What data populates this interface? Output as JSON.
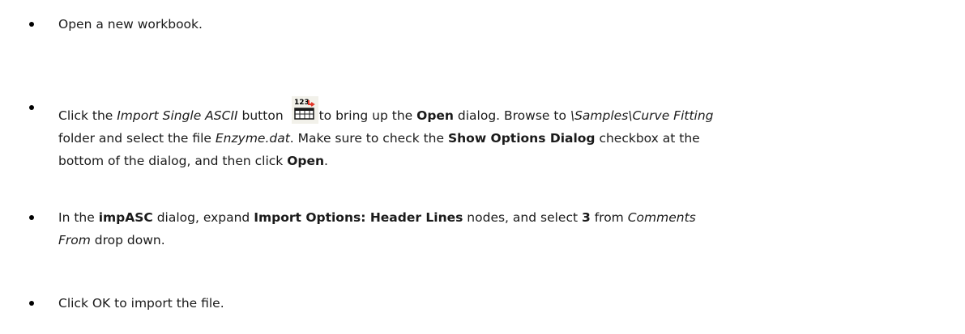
{
  "steps": [
    {
      "segments": [
        {
          "text": "Open a new workbook.",
          "style": "normal"
        }
      ]
    },
    {
      "lines": [
        [
          {
            "text": "Click the ",
            "style": "normal"
          },
          {
            "text": "Import Single ASCII",
            "style": "italic"
          },
          {
            "text": " button ",
            "style": "normal"
          },
          {
            "text": "to bring up the ",
            "style": "normal"
          },
          {
            "text": "Open",
            "style": "bold"
          },
          {
            "text": " dialog. Browse to ",
            "style": "normal"
          },
          {
            "text": "\\Samples\\Curve Fitting",
            "style": "italic"
          }
        ],
        [
          {
            "text": "folder and select the file ",
            "style": "normal"
          },
          {
            "text": "Enzyme.dat",
            "style": "italic"
          },
          {
            "text": ". Make sure to check the ",
            "style": "normal"
          },
          {
            "text": "Show Options Dialog",
            "style": "bold"
          },
          {
            "text": " checkbox at the",
            "style": "normal"
          }
        ],
        [
          {
            "text": "bottom of the dialog, and then click ",
            "style": "normal"
          },
          {
            "text": "Open",
            "style": "bold"
          },
          {
            "text": ".",
            "style": "normal"
          }
        ]
      ],
      "icon": "import-single-ascii-icon"
    },
    {
      "lines": [
        [
          {
            "text": "In the ",
            "style": "normal"
          },
          {
            "text": "impASC",
            "style": "bold"
          },
          {
            "text": " dialog, expand ",
            "style": "normal"
          },
          {
            "text": "Import Options: Header Lines",
            "style": "bold"
          },
          {
            "text": " nodes, and select ",
            "style": "normal"
          },
          {
            "text": "3",
            "style": "bold"
          },
          {
            "text": " from ",
            "style": "normal"
          },
          {
            "text": "Comments",
            "style": "italic"
          }
        ],
        [
          {
            "text": "From",
            "style": "italic"
          },
          {
            "text": " drop down.",
            "style": "normal"
          }
        ]
      ]
    },
    {
      "segments": [
        {
          "text": "Click OK to import the file.",
          "style": "normal"
        }
      ]
    }
  ],
  "icon_label": "123"
}
